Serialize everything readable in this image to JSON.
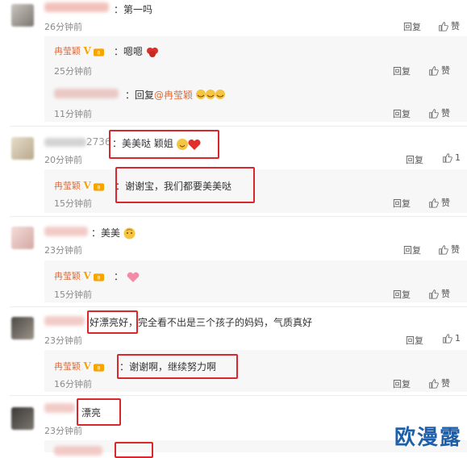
{
  "comments": [
    {
      "text": "：第一吗",
      "time": "26分钟前",
      "reply": "回复",
      "like": "赞"
    },
    {
      "author": "冉莹颖",
      "text": "：嗯嗯",
      "time": "25分钟前",
      "reply": "回复",
      "like": "赞"
    },
    {
      "prefix": "：回复",
      "mention": "@冉莹颖",
      "time": "11分钟前",
      "reply": "回复",
      "like": "赞"
    },
    {
      "name_suffix": "2736",
      "text": "：美美哒 颖姐",
      "time": "20分钟前",
      "reply": "回复",
      "like_count": "1"
    },
    {
      "author": "冉莹颖",
      "text": "：谢谢宝，我们都要美美哒",
      "time": "15分钟前",
      "reply": "回复",
      "like": "赞"
    },
    {
      "text": "：美美",
      "time": "23分钟前",
      "reply": "回复",
      "like": "赞"
    },
    {
      "author": "冉莹颖",
      "text": "：",
      "time": "15分钟前",
      "reply": "回复",
      "like": "赞"
    },
    {
      "text_a": "好漂亮好",
      "text_b": "，完全看不出是三个孩子的妈妈，气质真好",
      "time": "23分钟前",
      "reply": "回复",
      "like_count": "1"
    },
    {
      "author": "冉莹颖",
      "text": "：谢谢啊，继续努力啊",
      "time": "16分钟前",
      "reply": "回复",
      "like": "赞"
    },
    {
      "text": "漂亮",
      "time": "23分钟前",
      "reply": "回复",
      "like": "赞"
    }
  ],
  "watermark": "欧漫露",
  "colors": {
    "highlight": "#d9272e",
    "author": "#e06b3a",
    "watermark": "#1f5fa8"
  }
}
